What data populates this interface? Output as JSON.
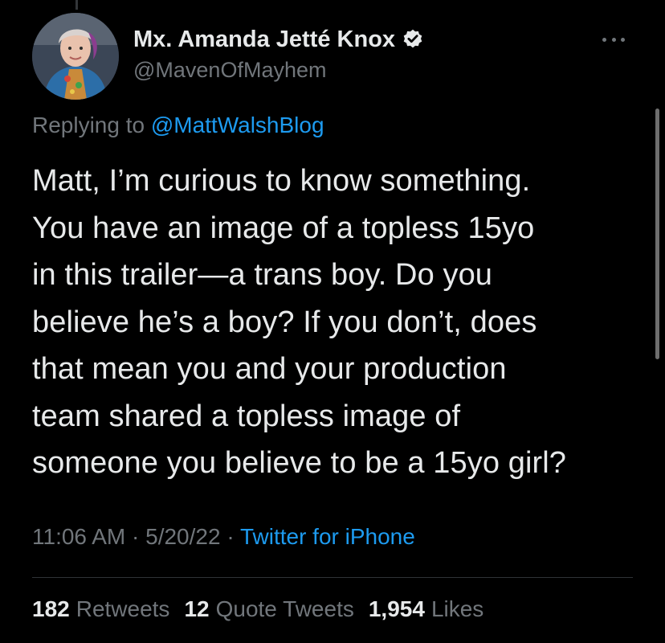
{
  "author": {
    "display_name": "Mx. Amanda Jetté Knox",
    "handle": "@MavenOfMayhem",
    "verified": true
  },
  "reply": {
    "prefix": "Replying to ",
    "mention": "@MattWalshBlog"
  },
  "tweet": {
    "lines": [
      "Matt, I’m curious to know something.",
      "You have an image of a topless 15yo",
      "in this trailer—a trans boy. Do you",
      "believe he’s a boy? If you don’t, does",
      "that mean you and your production",
      "team shared a topless image of",
      "someone you believe to be a 15yo girl?"
    ]
  },
  "meta": {
    "time": "11:06 AM",
    "separator": " · ",
    "date": "5/20/22",
    "source": "Twitter for iPhone"
  },
  "stats": {
    "retweets_count": "182",
    "retweets_label": "Retweets",
    "quotes_count": "12",
    "quotes_label": "Quote Tweets",
    "likes_count": "1,954",
    "likes_label": "Likes"
  },
  "icons": {
    "verified": "verified-badge-icon",
    "more": "more-options-icon"
  },
  "colors": {
    "background": "#000000",
    "text": "#e7e9ea",
    "secondary": "#71767b",
    "link": "#1d9bf0",
    "divider": "#2f3336"
  }
}
